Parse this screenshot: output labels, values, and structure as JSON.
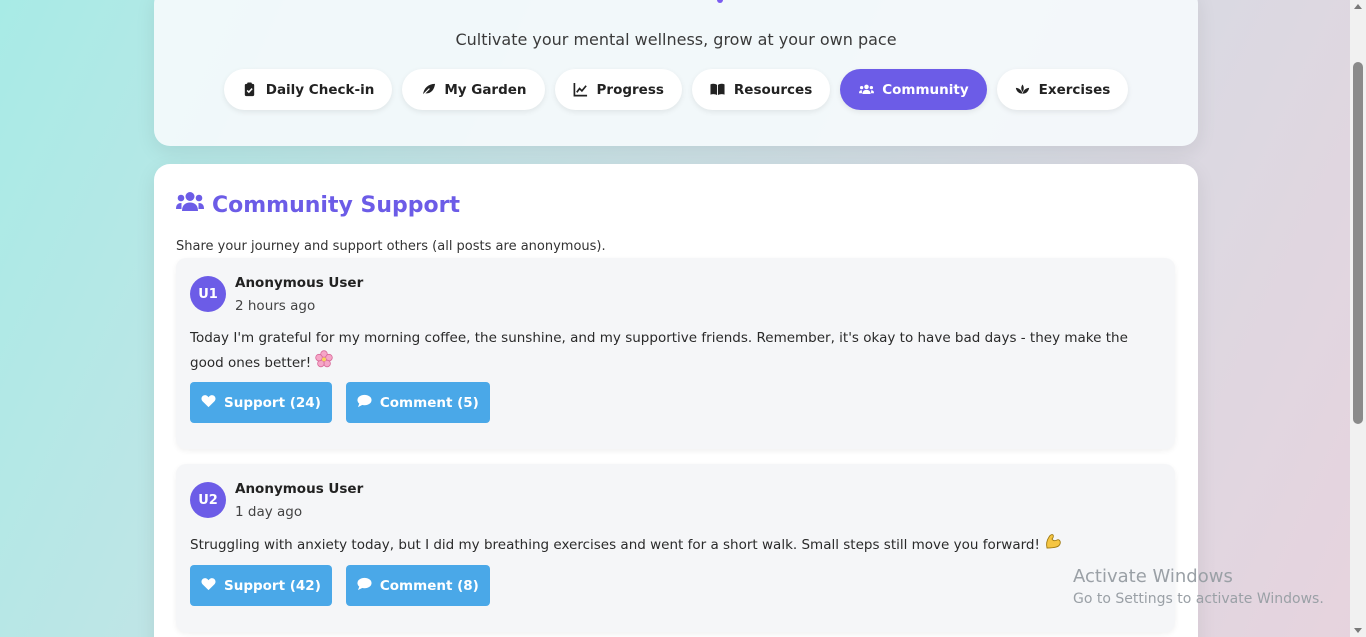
{
  "header": {
    "subtitle": "Cultivate your mental wellness, grow at your own pace"
  },
  "nav": {
    "tabs": [
      {
        "label": "Daily Check-in",
        "icon": "clipboard-check-icon"
      },
      {
        "label": "My Garden",
        "icon": "leaf-icon"
      },
      {
        "label": "Progress",
        "icon": "chart-line-icon"
      },
      {
        "label": "Resources",
        "icon": "book-open-icon"
      },
      {
        "label": "Community",
        "icon": "users-icon",
        "active": true
      },
      {
        "label": "Exercises",
        "icon": "spa-icon"
      }
    ]
  },
  "community": {
    "title": "Community Support",
    "description": "Share your journey and support others (all posts are anonymous).",
    "posts": [
      {
        "avatar": "U1",
        "author": "Anonymous User",
        "time": "2 hours ago",
        "content": "Today I'm grateful for my morning coffee, the sunshine, and my supportive friends. Remember, it's okay to have bad days - they make the good ones better!",
        "emoji": "cherry-blossom",
        "support_label": "Support (24)",
        "comment_label": "Comment (5)"
      },
      {
        "avatar": "U2",
        "author": "Anonymous User",
        "time": "1 day ago",
        "content": "Struggling with anxiety today, but I did my breathing exercises and went for a short walk. Small steps still move you forward!",
        "emoji": "flexed-biceps",
        "support_label": "Support (42)",
        "comment_label": "Comment (8)"
      }
    ]
  },
  "watermark": {
    "title": "Activate Windows",
    "subtitle": "Go to Settings to activate Windows."
  },
  "colors": {
    "accent": "#6c5ce7",
    "action_button": "#4aa8e8"
  }
}
